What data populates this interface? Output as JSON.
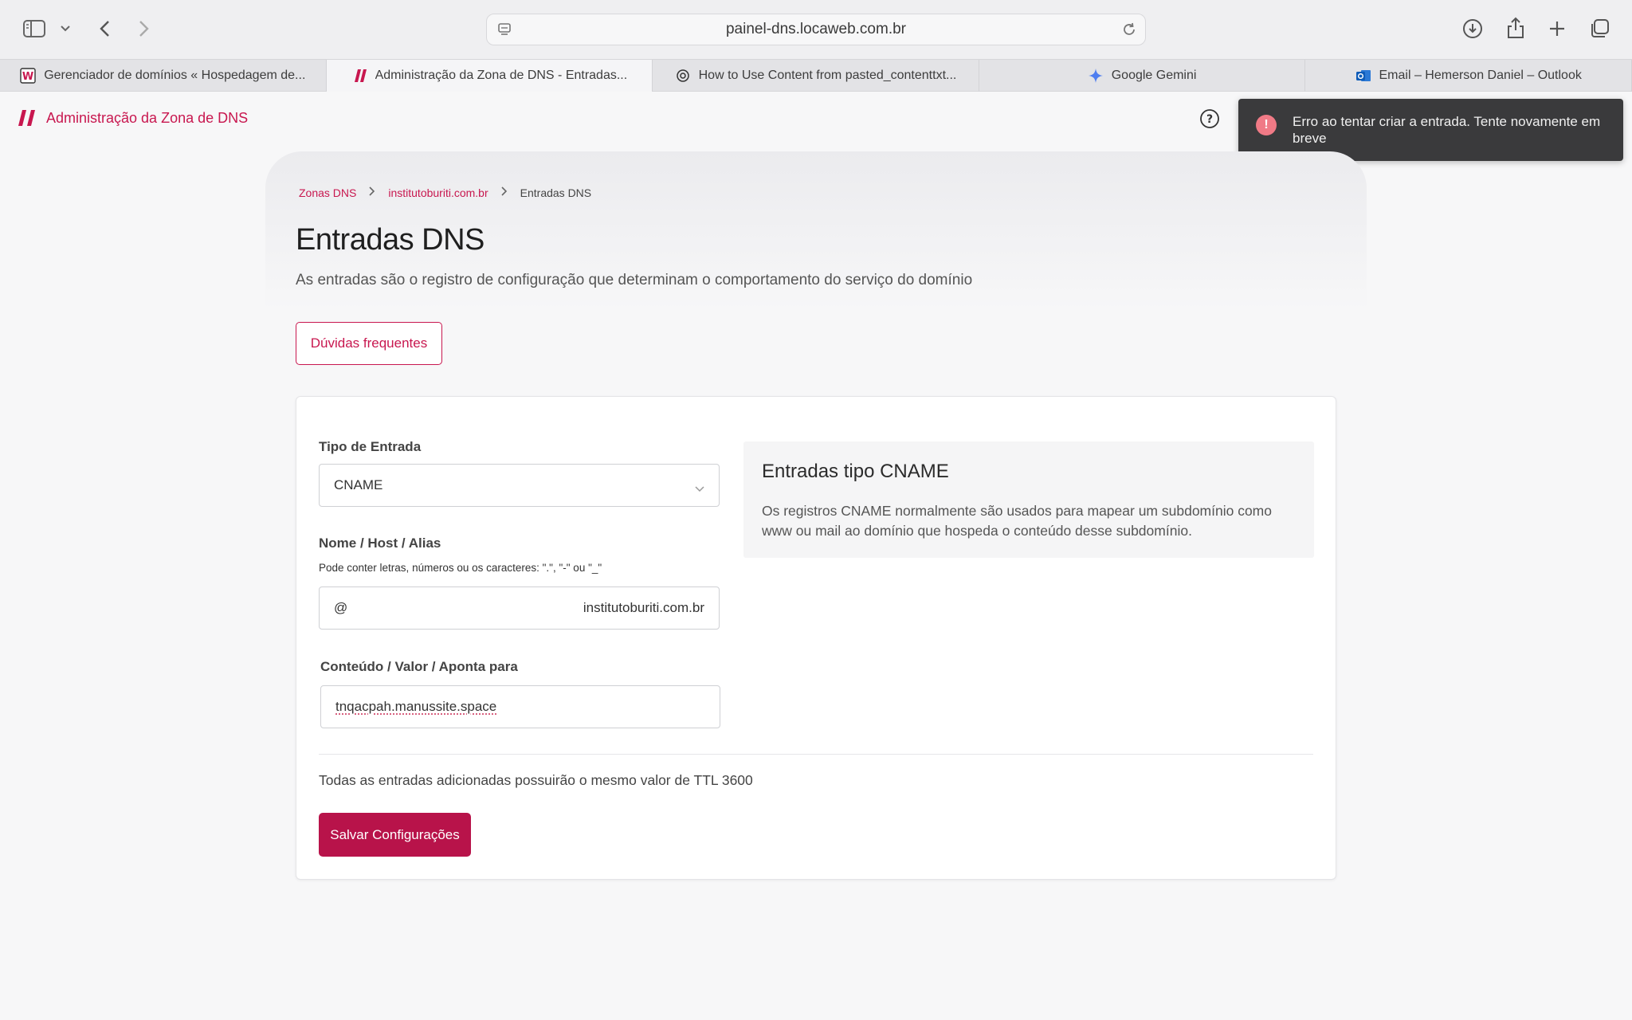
{
  "browser": {
    "url": "painel-dns.locaweb.com.br",
    "tabs": [
      {
        "label": "Gerenciador de domínios « Hospedagem de...",
        "active": false,
        "icon": "locaweb-w-icon"
      },
      {
        "label": "Administração da Zona de DNS - Entradas...",
        "active": true,
        "icon": "locaweb-logo-icon"
      },
      {
        "label": "How to Use Content from pasted_contenttxt...",
        "active": false,
        "icon": "openai-icon"
      },
      {
        "label": "Google Gemini",
        "active": false,
        "icon": "gemini-icon"
      },
      {
        "label": "Email – Hemerson Daniel – Outlook",
        "active": false,
        "icon": "outlook-icon"
      }
    ]
  },
  "app": {
    "title": "Administração da Zona de DNS",
    "brand_color": "#c8174f"
  },
  "toast": {
    "message": "Erro ao tentar criar a entrada. Tente novamente em breve",
    "icon_text": "!"
  },
  "breadcrumb": {
    "items": [
      "Zonas DNS",
      "institutoburiti.com.br",
      "Entradas DNS"
    ]
  },
  "page": {
    "title": "Entradas DNS",
    "subtitle": "As entradas são o registro de configuração que determinam o comportamento do serviço do domínio",
    "faq_button": "Dúvidas frequentes"
  },
  "form": {
    "type_label": "Tipo de Entrada",
    "type_value": "CNAME",
    "name_label": "Nome / Host / Alias",
    "name_hint": "Pode conter letras, números ou os caracteres: \".\", \"-\" ou \"_\"",
    "name_value": "@",
    "name_suffix": "institutoburiti.com.br",
    "content_label": "Conteúdo / Valor / Aponta para",
    "content_value": "tnqacpah.manussite.space",
    "ttl_note": "Todas as entradas adicionadas possuirão o mesmo valor de TTL 3600",
    "save_button": "Salvar Configurações"
  },
  "info": {
    "title": "Entradas tipo CNAME",
    "text": "Os registros CNAME normalmente são usados para mapear um subdomínio como www ou mail ao domínio que hospeda o conteúdo desse subdomínio."
  }
}
